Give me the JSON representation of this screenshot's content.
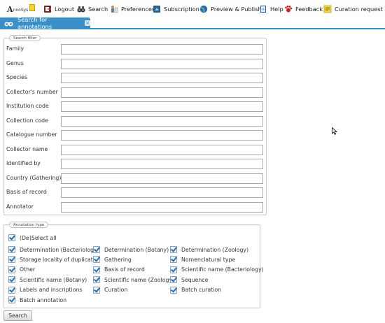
{
  "toolbar": {
    "logo_letter": "A",
    "logo_text": "nnoSys",
    "items": [
      {
        "label": "Logout",
        "icon": "logout-icon"
      },
      {
        "label": "Search",
        "icon": "binoculars-icon"
      },
      {
        "label": "Preferences",
        "icon": "preferences-icon"
      },
      {
        "label": "Subscription",
        "icon": "subscription-icon"
      },
      {
        "label": "Preview & Publish",
        "icon": "globe-icon"
      },
      {
        "label": "Help",
        "icon": "help-icon"
      },
      {
        "label": "Feedback",
        "icon": "feedback-icon"
      },
      {
        "label": "Curation request",
        "icon": "curation-request-icon"
      }
    ]
  },
  "tab": {
    "label": "Search for annotations",
    "close": "×"
  },
  "search_filter": {
    "legend": "Search filter",
    "fields": [
      {
        "label": "Family",
        "value": ""
      },
      {
        "label": "Genus",
        "value": ""
      },
      {
        "label": "Species",
        "value": ""
      },
      {
        "label": "Collector's number",
        "value": ""
      },
      {
        "label": "Institution code",
        "value": ""
      },
      {
        "label": "Collection code",
        "value": ""
      },
      {
        "label": "Catalogue number",
        "value": ""
      },
      {
        "label": "Collector name",
        "value": ""
      },
      {
        "label": "Identified by",
        "value": ""
      },
      {
        "label": "Country (Gathering)",
        "value": ""
      },
      {
        "label": "Basis of record",
        "value": ""
      },
      {
        "label": "Annotator",
        "value": ""
      }
    ]
  },
  "annotation_type": {
    "legend": "Annotation type",
    "select_all": "(De)Select all",
    "options": [
      "Determination (Bacteriology)",
      "Determination (Botany)",
      "Determination (Zoology)",
      "Storage locality of duplicates",
      "Gathering",
      "Nomenclatural type",
      "Other",
      "Basis of record",
      "Scientific name (Bacteriology)",
      "Scientific name (Botany)",
      "Scientific name (Zoology)",
      "Sequence",
      "Labels and inscriptions",
      "Curation",
      "Batch curation",
      "Batch annotation"
    ],
    "checked": true
  },
  "search_button": "Search",
  "colors": {
    "accent": "#3b8fc7",
    "check": "#2b6fa8"
  }
}
